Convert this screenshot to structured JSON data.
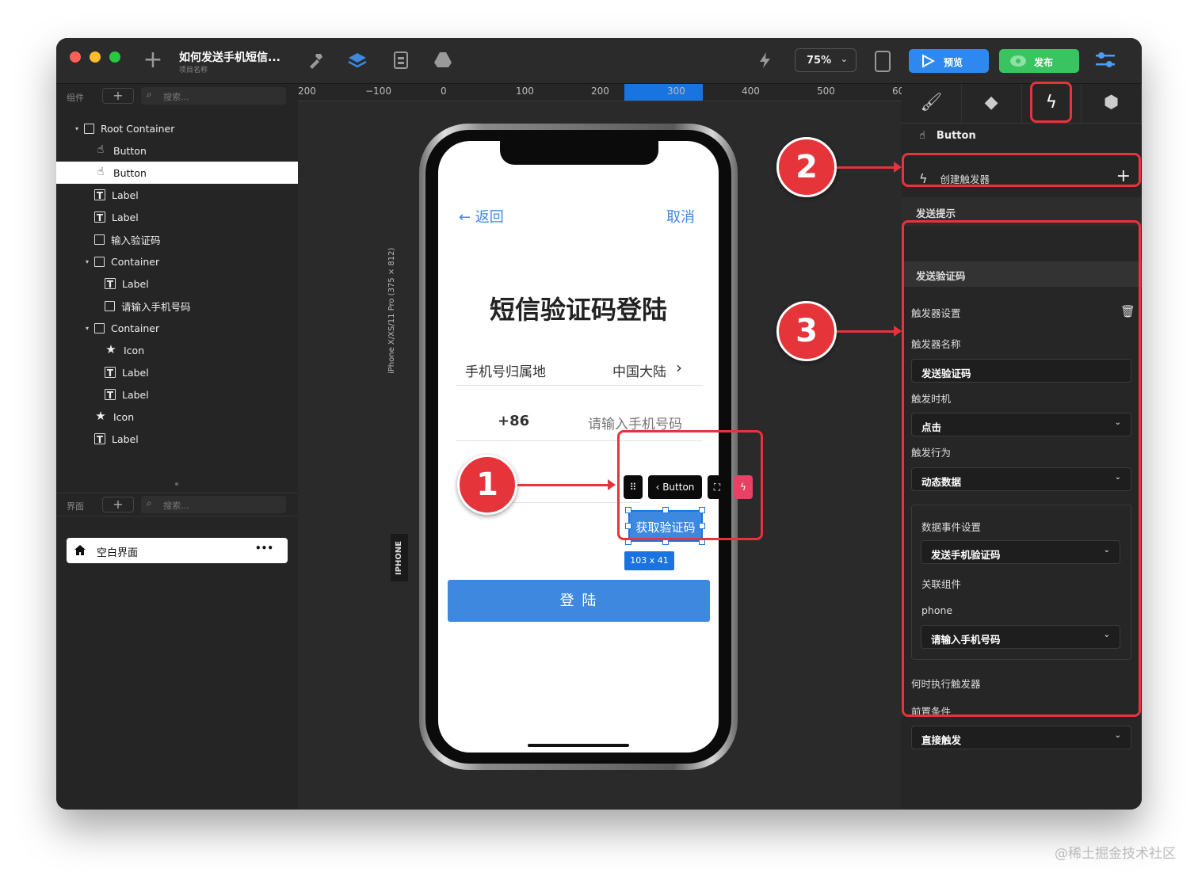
{
  "app": {
    "project_title": "如何发送手机短信...",
    "project_subtitle": "项目名称",
    "zoom": "75%",
    "preview_label": "预览",
    "publish_label": "发布"
  },
  "left_panel": {
    "components_header": "组件",
    "search_placeholder": "搜索...",
    "tree": [
      {
        "label": "Root Container",
        "icon": "box-icon",
        "depth": 0,
        "expanded": true
      },
      {
        "label": "Button",
        "icon": "hand-icon",
        "depth": 1
      },
      {
        "label": "Button",
        "icon": "hand-icon",
        "depth": 1,
        "selected": true
      },
      {
        "label": "Label",
        "icon": "text-icon",
        "depth": 1
      },
      {
        "label": "Label",
        "icon": "text-icon",
        "depth": 1
      },
      {
        "label": "输入验证码",
        "icon": "box-icon",
        "depth": 1
      },
      {
        "label": "Container",
        "icon": "box-icon",
        "depth": 1,
        "expanded": true
      },
      {
        "label": "Label",
        "icon": "text-icon",
        "depth": 2
      },
      {
        "label": "请输入手机号码",
        "icon": "box-icon",
        "depth": 2
      },
      {
        "label": "Container",
        "icon": "box-icon",
        "depth": 1,
        "expanded": true
      },
      {
        "label": "Icon",
        "icon": "star-icon",
        "depth": 2
      },
      {
        "label": "Label",
        "icon": "text-icon",
        "depth": 2
      },
      {
        "label": "Label",
        "icon": "text-icon",
        "depth": 2
      },
      {
        "label": "Icon",
        "icon": "star-icon",
        "depth": 1
      },
      {
        "label": "Label",
        "icon": "text-icon",
        "depth": 1
      }
    ],
    "pages_header": "界面",
    "pages_search_placeholder": "搜索...",
    "page_item": "空白界面",
    "page_more": "•••"
  },
  "ruler": {
    "ticks": [
      "200",
      "−100",
      "0",
      "100",
      "200",
      "300",
      "400",
      "500",
      "60"
    ]
  },
  "canvas": {
    "device_label": "iPhone X/XS/11 Pro (375 × 812)",
    "device_badge": "IPHONE",
    "back": "← 返回",
    "cancel": "取消",
    "title": "短信验证码登陆",
    "region_label": "手机号归属地",
    "region_value": "中国大陆",
    "country_code": "+86",
    "phone_placeholder": "请输入手机号码",
    "get_code_button": "获取验证码",
    "selection_toolbar_label": "Button",
    "dimension_badge": "103 x 41",
    "login_button": "登 陆"
  },
  "right_panel": {
    "component_type": "Button",
    "create_trigger": "创建触发器",
    "trigger_send_hint": "发送提示",
    "trigger_send_code": "发送验证码",
    "trigger_settings": "触发器设置",
    "trigger_name_label": "触发器名称",
    "trigger_name_value": "发送验证码",
    "trigger_timing_label": "触发时机",
    "trigger_timing_value": "点击",
    "trigger_action_label": "触发行为",
    "trigger_action_value": "动态数据",
    "data_event_settings": "数据事件设置",
    "data_event_value": "发送手机验证码",
    "linked_component_label": "关联组件",
    "phone_label": "phone",
    "phone_value": "请输入手机号码",
    "when_execute": "何时执行触发器",
    "precondition_label": "前置条件",
    "precondition_value": "直接触发"
  },
  "annotations": {
    "step1": "1",
    "step2": "2",
    "step3": "3",
    "color": "#e5343a"
  },
  "watermark": "@稀土掘金技术社区"
}
